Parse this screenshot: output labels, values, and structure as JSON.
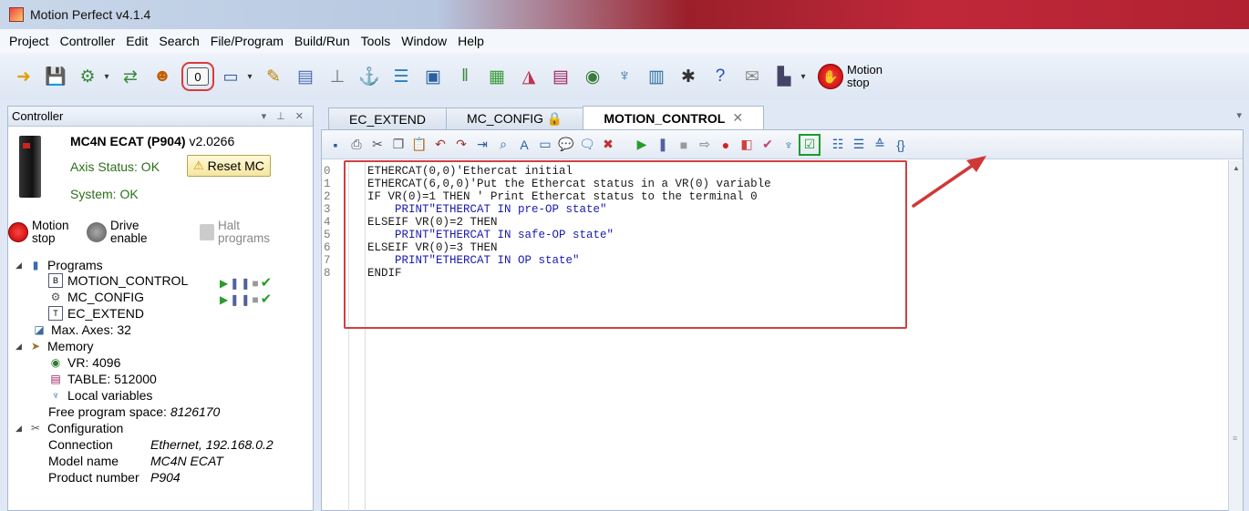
{
  "window": {
    "title": "Motion Perfect v4.1.4"
  },
  "menu": [
    {
      "label": "Project"
    },
    {
      "label": "Controller"
    },
    {
      "label": "Edit"
    },
    {
      "label": "Search"
    },
    {
      "label": "File/Program"
    },
    {
      "label": "Build/Run"
    },
    {
      "label": "Tools"
    },
    {
      "label": "Window"
    },
    {
      "label": "Help"
    }
  ],
  "toolbar": {
    "motion_stop_label": "Motion stop",
    "icons": [
      "connect-icon",
      "save-icon",
      "axis-params-icon",
      "io-icon",
      "terminal-icon",
      "highlighted-terminal-icon",
      "window-icon",
      "oscilloscope-icon",
      "table-icon",
      "io-viewer-icon",
      "robot-icon",
      "cam-icon",
      "jog-icon",
      "registers-icon",
      "vr-icon",
      "chart-icon",
      "list-icon",
      "vr-view-icon",
      "local-vars-icon",
      "watch-icon",
      "settings-icon",
      "help-icon",
      "notes-icon",
      "iec-icon"
    ]
  },
  "left_pane": {
    "header": "Controller",
    "header_controls": "▾ ⊥ ✕",
    "controller": {
      "model": "MC4N ECAT (P904)",
      "version": "v2.0266",
      "axis_status": "Axis Status: OK",
      "reset_label": "Reset MC",
      "system_status": "System: OK"
    },
    "actions": {
      "motion_stop": "Motion stop",
      "drive_enable": "Drive enable",
      "halt_programs": "Halt programs"
    },
    "tree": {
      "programs": "Programs",
      "program_items": [
        "MOTION_CONTROL",
        "MC_CONFIG",
        "EC_EXTEND"
      ],
      "max_axes": "Max. Axes: 32",
      "memory": "Memory",
      "vr": "VR: 4096",
      "table": "TABLE: 512000",
      "local_vars": "Local variables",
      "free_space_label": "Free program space:",
      "free_space_value": "8126170",
      "configuration": "Configuration",
      "connection_label": "Connection",
      "connection_value": "Ethernet, 192.168.0.2",
      "model_label": "Model name",
      "model_value": "MC4N ECAT",
      "product_label": "Product number",
      "product_value": "P904"
    }
  },
  "tabs": [
    {
      "label": "EC_EXTEND"
    },
    {
      "label": "MC_CONFIG 🔒"
    },
    {
      "label": "MOTION_CONTROL"
    }
  ],
  "editor": {
    "line_numbers": [
      "0",
      "1",
      "2",
      "3",
      "4",
      "5",
      "6",
      "7",
      "8"
    ],
    "lines": [
      "ETHERCAT(0,0)'Ethercat initial",
      "ETHERCAT(6,0,0)'Put the Ethercat status in a VR(0) variable",
      "IF VR(0)=1 THEN ' Print Ethercat status to the terminal 0",
      "    PRINT\"ETHERCAT IN pre-OP state\"",
      "ELSEIF VR(0)=2 THEN",
      "    PRINT\"ETHERCAT IN safe-OP state\"",
      "ELSEIF VR(0)=3 THEN",
      "    PRINT\"ETHERCAT IN OP state\"",
      "ENDIF"
    ]
  },
  "colors": {
    "highlight_red": "#d04040",
    "accent_green": "#2d6f1a"
  }
}
